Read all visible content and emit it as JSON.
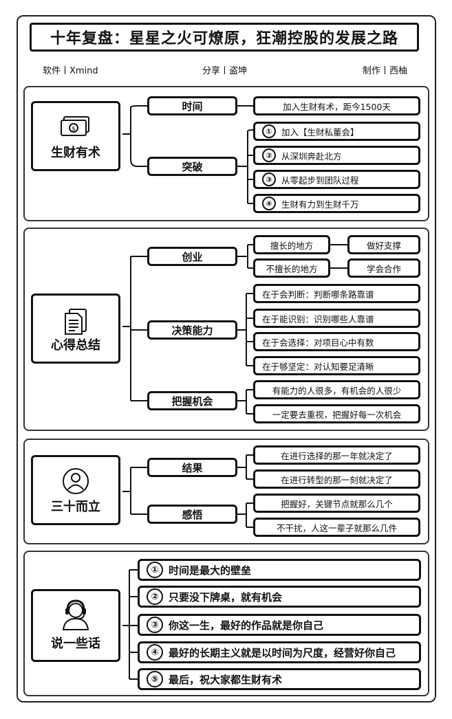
{
  "title": "十年复盘：星星之火可燎原，狂潮控股的发展之路",
  "meta": {
    "software": "软件丨Xmind",
    "share": "分享丨盗坤",
    "author": "制作丨西柚"
  },
  "sections": [
    {
      "label": "生财有术",
      "icon": "money-icon",
      "branches": [
        {
          "label": "时间",
          "leaves": [
            "加入生财有术，距今1500天"
          ]
        },
        {
          "label": "突破",
          "leaves": [
            {
              "num": "①",
              "text": "加入【生财私董会】"
            },
            {
              "num": "②",
              "text": "从深圳奔赴北方"
            },
            {
              "num": "③",
              "text": "从零起步到团队过程"
            },
            {
              "num": "④",
              "text": "生财有力到生财千万"
            }
          ]
        }
      ]
    },
    {
      "label": "心得总结",
      "icon": "document-icon",
      "branches": [
        {
          "label": "创业",
          "pairs": [
            {
              "left": "擅长的地方",
              "right": "做好支撑"
            },
            {
              "left": "不擅长的地方",
              "right": "学会合作"
            }
          ]
        },
        {
          "label": "决策能力",
          "leaves": [
            "在于会判断：判断哪条路靠谱",
            "在于能识别：识别哪些人靠谱",
            "在于会选择：对项目心中有数",
            "在于够坚定：对认知要足清晰"
          ]
        },
        {
          "label": "把握机会",
          "leaves": [
            "有能力的人很多，有机会的人很少",
            "一定要去重视，把握好每一次机会"
          ]
        }
      ]
    },
    {
      "label": "三十而立",
      "icon": "user-icon",
      "branches": [
        {
          "label": "结果",
          "leaves": [
            "在进行选择的那一年就决定了",
            "在进行转型的那一刻就决定了"
          ]
        },
        {
          "label": "感悟",
          "leaves": [
            "把握好，关键节点就那么几个",
            "不干扰，人这一辈子就那么几件"
          ]
        }
      ]
    },
    {
      "label": "说一些话",
      "icon": "headset-person-icon",
      "leaves": [
        {
          "num": "①",
          "text": "时间是最大的壁垒"
        },
        {
          "num": "②",
          "text": "只要没下牌桌，就有机会"
        },
        {
          "num": "③",
          "text": "你这一生，最好的作品就是你自己"
        },
        {
          "num": "④",
          "text": "最好的长期主义就是以时间为尺度，经营好你自己"
        },
        {
          "num": "⑤",
          "text": "最后，祝大家都生财有术"
        }
      ]
    }
  ]
}
